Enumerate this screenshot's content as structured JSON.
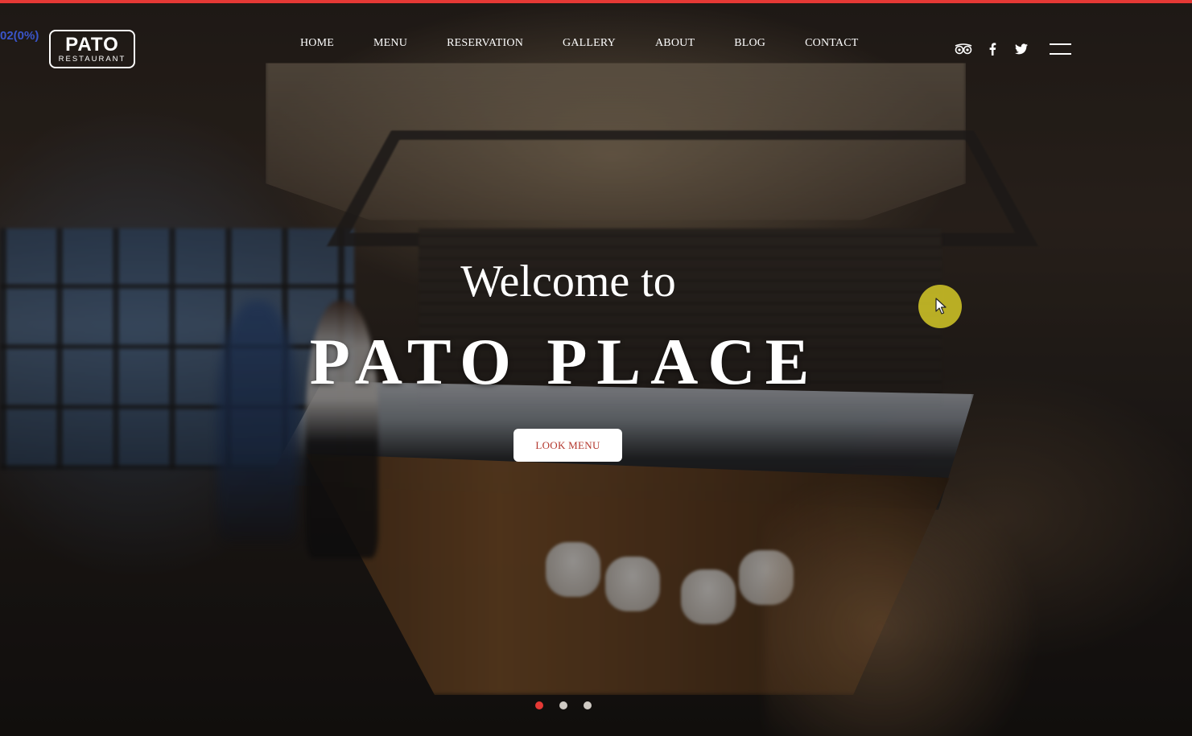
{
  "debug": {
    "text": "02(0%)"
  },
  "logo": {
    "line1": "PATO",
    "line2": "RESTAURANT"
  },
  "nav": {
    "items": [
      {
        "label": "HOME"
      },
      {
        "label": "MENU"
      },
      {
        "label": "RESERVATION"
      },
      {
        "label": "GALLERY"
      },
      {
        "label": "ABOUT"
      },
      {
        "label": "BLOG"
      },
      {
        "label": "CONTACT"
      }
    ]
  },
  "social": {
    "icons": [
      "tripadvisor-icon",
      "facebook-icon",
      "twitter-icon"
    ]
  },
  "menu_toggle": {
    "icon": "hamburger-menu-icon"
  },
  "hero": {
    "welcome": "Welcome to",
    "title": "PATO PLACE",
    "button_label": "LOOK MENU"
  },
  "slider": {
    "slide_count": 3,
    "active_index": 0
  },
  "colors": {
    "accent": "#e53935",
    "button_text": "#b3362c",
    "cursor_highlight": "#dcd028",
    "debug_text": "#3a55c9"
  }
}
